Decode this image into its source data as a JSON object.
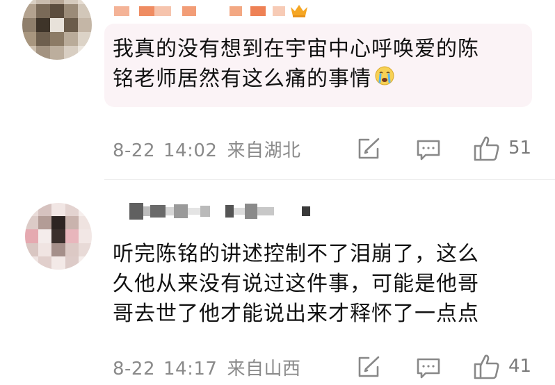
{
  "comments": [
    {
      "text_line1": "我真的没有想到在宇宙中心呼唤爱的陈",
      "text_line2": "铭老师居然有这么痛的事情",
      "emoji": "crying-face-emoji",
      "date": "8-22",
      "time": "14:02",
      "location": "来自湖北",
      "likes": "51"
    },
    {
      "text_line1": "听完陈铭的讲述控制不了泪崩了，这么",
      "text_line2": "久他从来没有说过这件事，可能是他哥",
      "text_line3": "哥去世了他才能说出来才释怀了一点点",
      "date": "8-22",
      "time": "14:17",
      "location": "来自山西",
      "likes": "41"
    }
  ],
  "icons": {
    "forward": "share-edit-icon",
    "comment": "comment-icon",
    "like": "thumbs-up-icon",
    "badge": "crown-icon"
  },
  "colors": {
    "bubble_bg": "#fbf3f6",
    "meta_text": "#8a8a8a",
    "crown": "#f5a623",
    "name_mosaic": "#f08a5d"
  }
}
